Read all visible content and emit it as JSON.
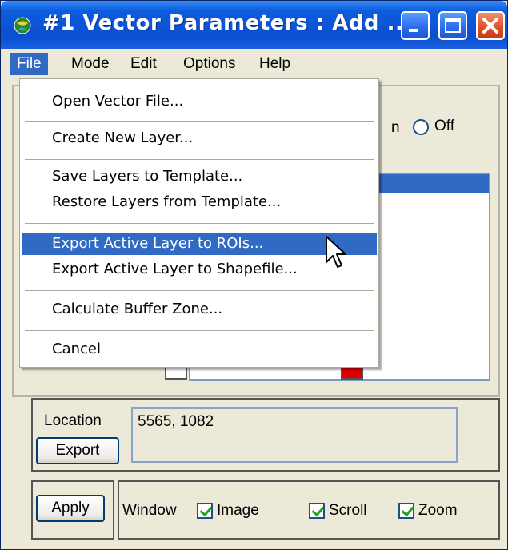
{
  "window": {
    "title": "#1 Vector Parameters : Add ...",
    "title_icon": "globe-icon",
    "buttons": [
      "minimize-icon",
      "maximize-icon",
      "close-icon"
    ]
  },
  "menubar": {
    "items": [
      "File",
      "Mode",
      "Edit",
      "Options",
      "Help"
    ],
    "active": "File"
  },
  "file_menu": {
    "items": [
      "Open Vector File...",
      "Create New Layer...",
      "Save Layers to Template...",
      "Restore Layers from Template...",
      "Export Active Layer to ROIs...",
      "Export Active Layer to Shapefile...",
      "Calculate Buffer Zone...",
      "Cancel"
    ],
    "highlighted": "Export Active Layer to ROIs..."
  },
  "background": {
    "radio_partial_label": "n",
    "radio_off_label": "Off",
    "swatch_colors": [
      "#ffffff",
      "#e00000"
    ]
  },
  "location": {
    "label": "Location",
    "value": "5565, 1082",
    "export_label": "Export"
  },
  "bottom": {
    "apply_label": "Apply",
    "window_label": "Window",
    "checkboxes": [
      {
        "label": "Image",
        "checked": true
      },
      {
        "label": "Scroll",
        "checked": true
      },
      {
        "label": "Zoom",
        "checked": true
      }
    ]
  },
  "colors": {
    "titlebar": "#0a4fcf",
    "highlight": "#316ac5",
    "window_bg": "#ece9d8"
  }
}
